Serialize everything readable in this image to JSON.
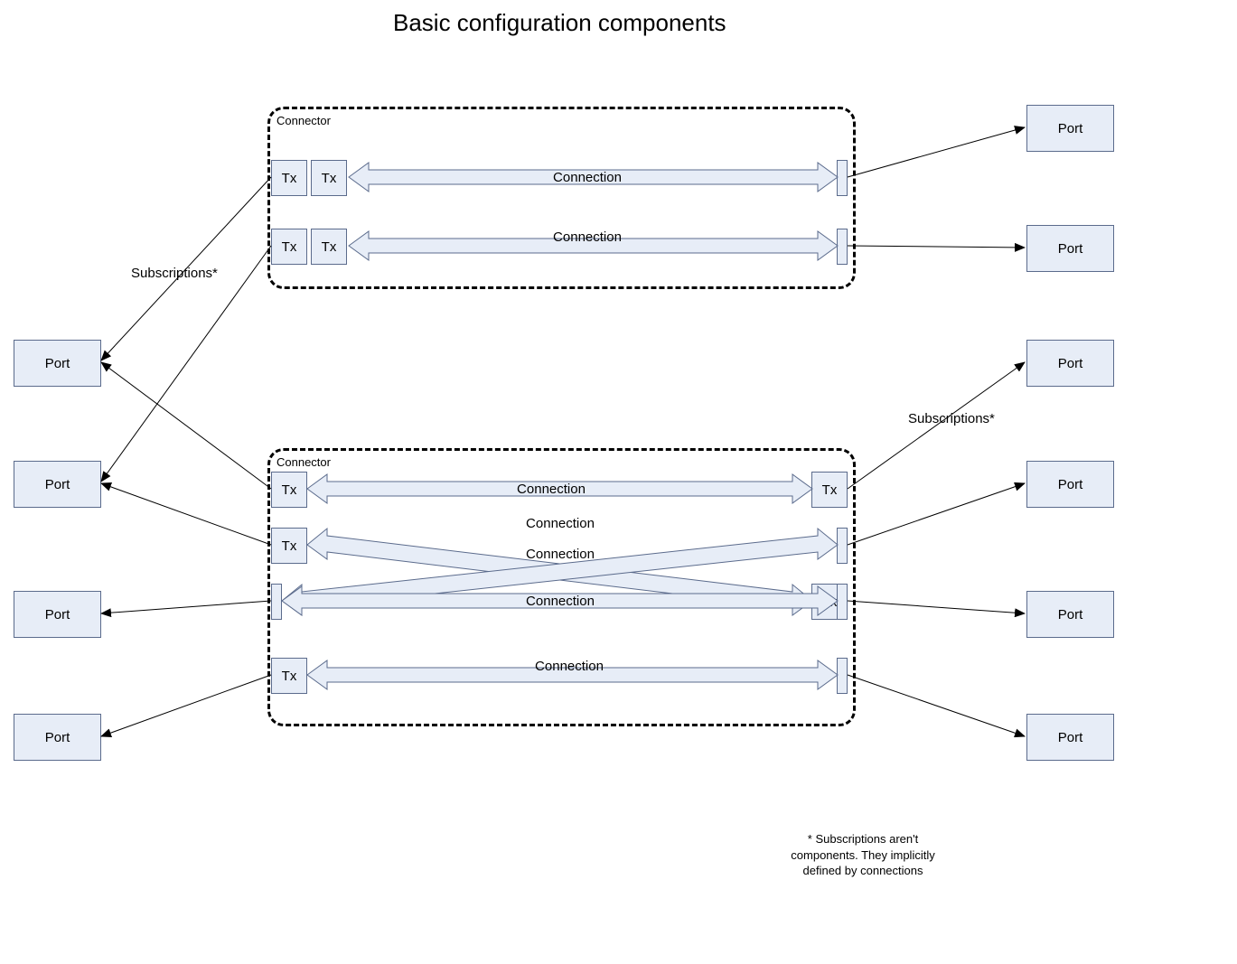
{
  "title": "Basic configuration components",
  "labels": {
    "connector": "Connector",
    "connection": "Connection",
    "tx": "Tx",
    "port": "Port",
    "subscriptions": "Subscriptions*"
  },
  "footnote": "* Subscriptions aren't components. They implicitly defined by connections",
  "connectors": [
    {
      "id": "top",
      "connections": [
        {
          "left_tx": [
            "Tx",
            "Tx"
          ],
          "right_tx": []
        },
        {
          "left_tx": [
            "Tx",
            "Tx"
          ],
          "right_tx": []
        }
      ]
    },
    {
      "id": "bottom",
      "connections": [
        {
          "left_tx": [
            "Tx"
          ],
          "right_tx": [
            "Tx"
          ]
        },
        {
          "left_tx": [
            "Tx"
          ],
          "right_tx": []
        },
        {
          "left_tx": [],
          "right_tx": [
            "Tx"
          ]
        },
        {
          "left_tx": [],
          "right_tx": []
        },
        {
          "left_tx": [
            "Tx"
          ],
          "right_tx": []
        }
      ]
    }
  ],
  "ports_left": [
    "Port",
    "Port",
    "Port",
    "Port"
  ],
  "ports_right": [
    "Port",
    "Port",
    "Port",
    "Port",
    "Port",
    "Port"
  ]
}
